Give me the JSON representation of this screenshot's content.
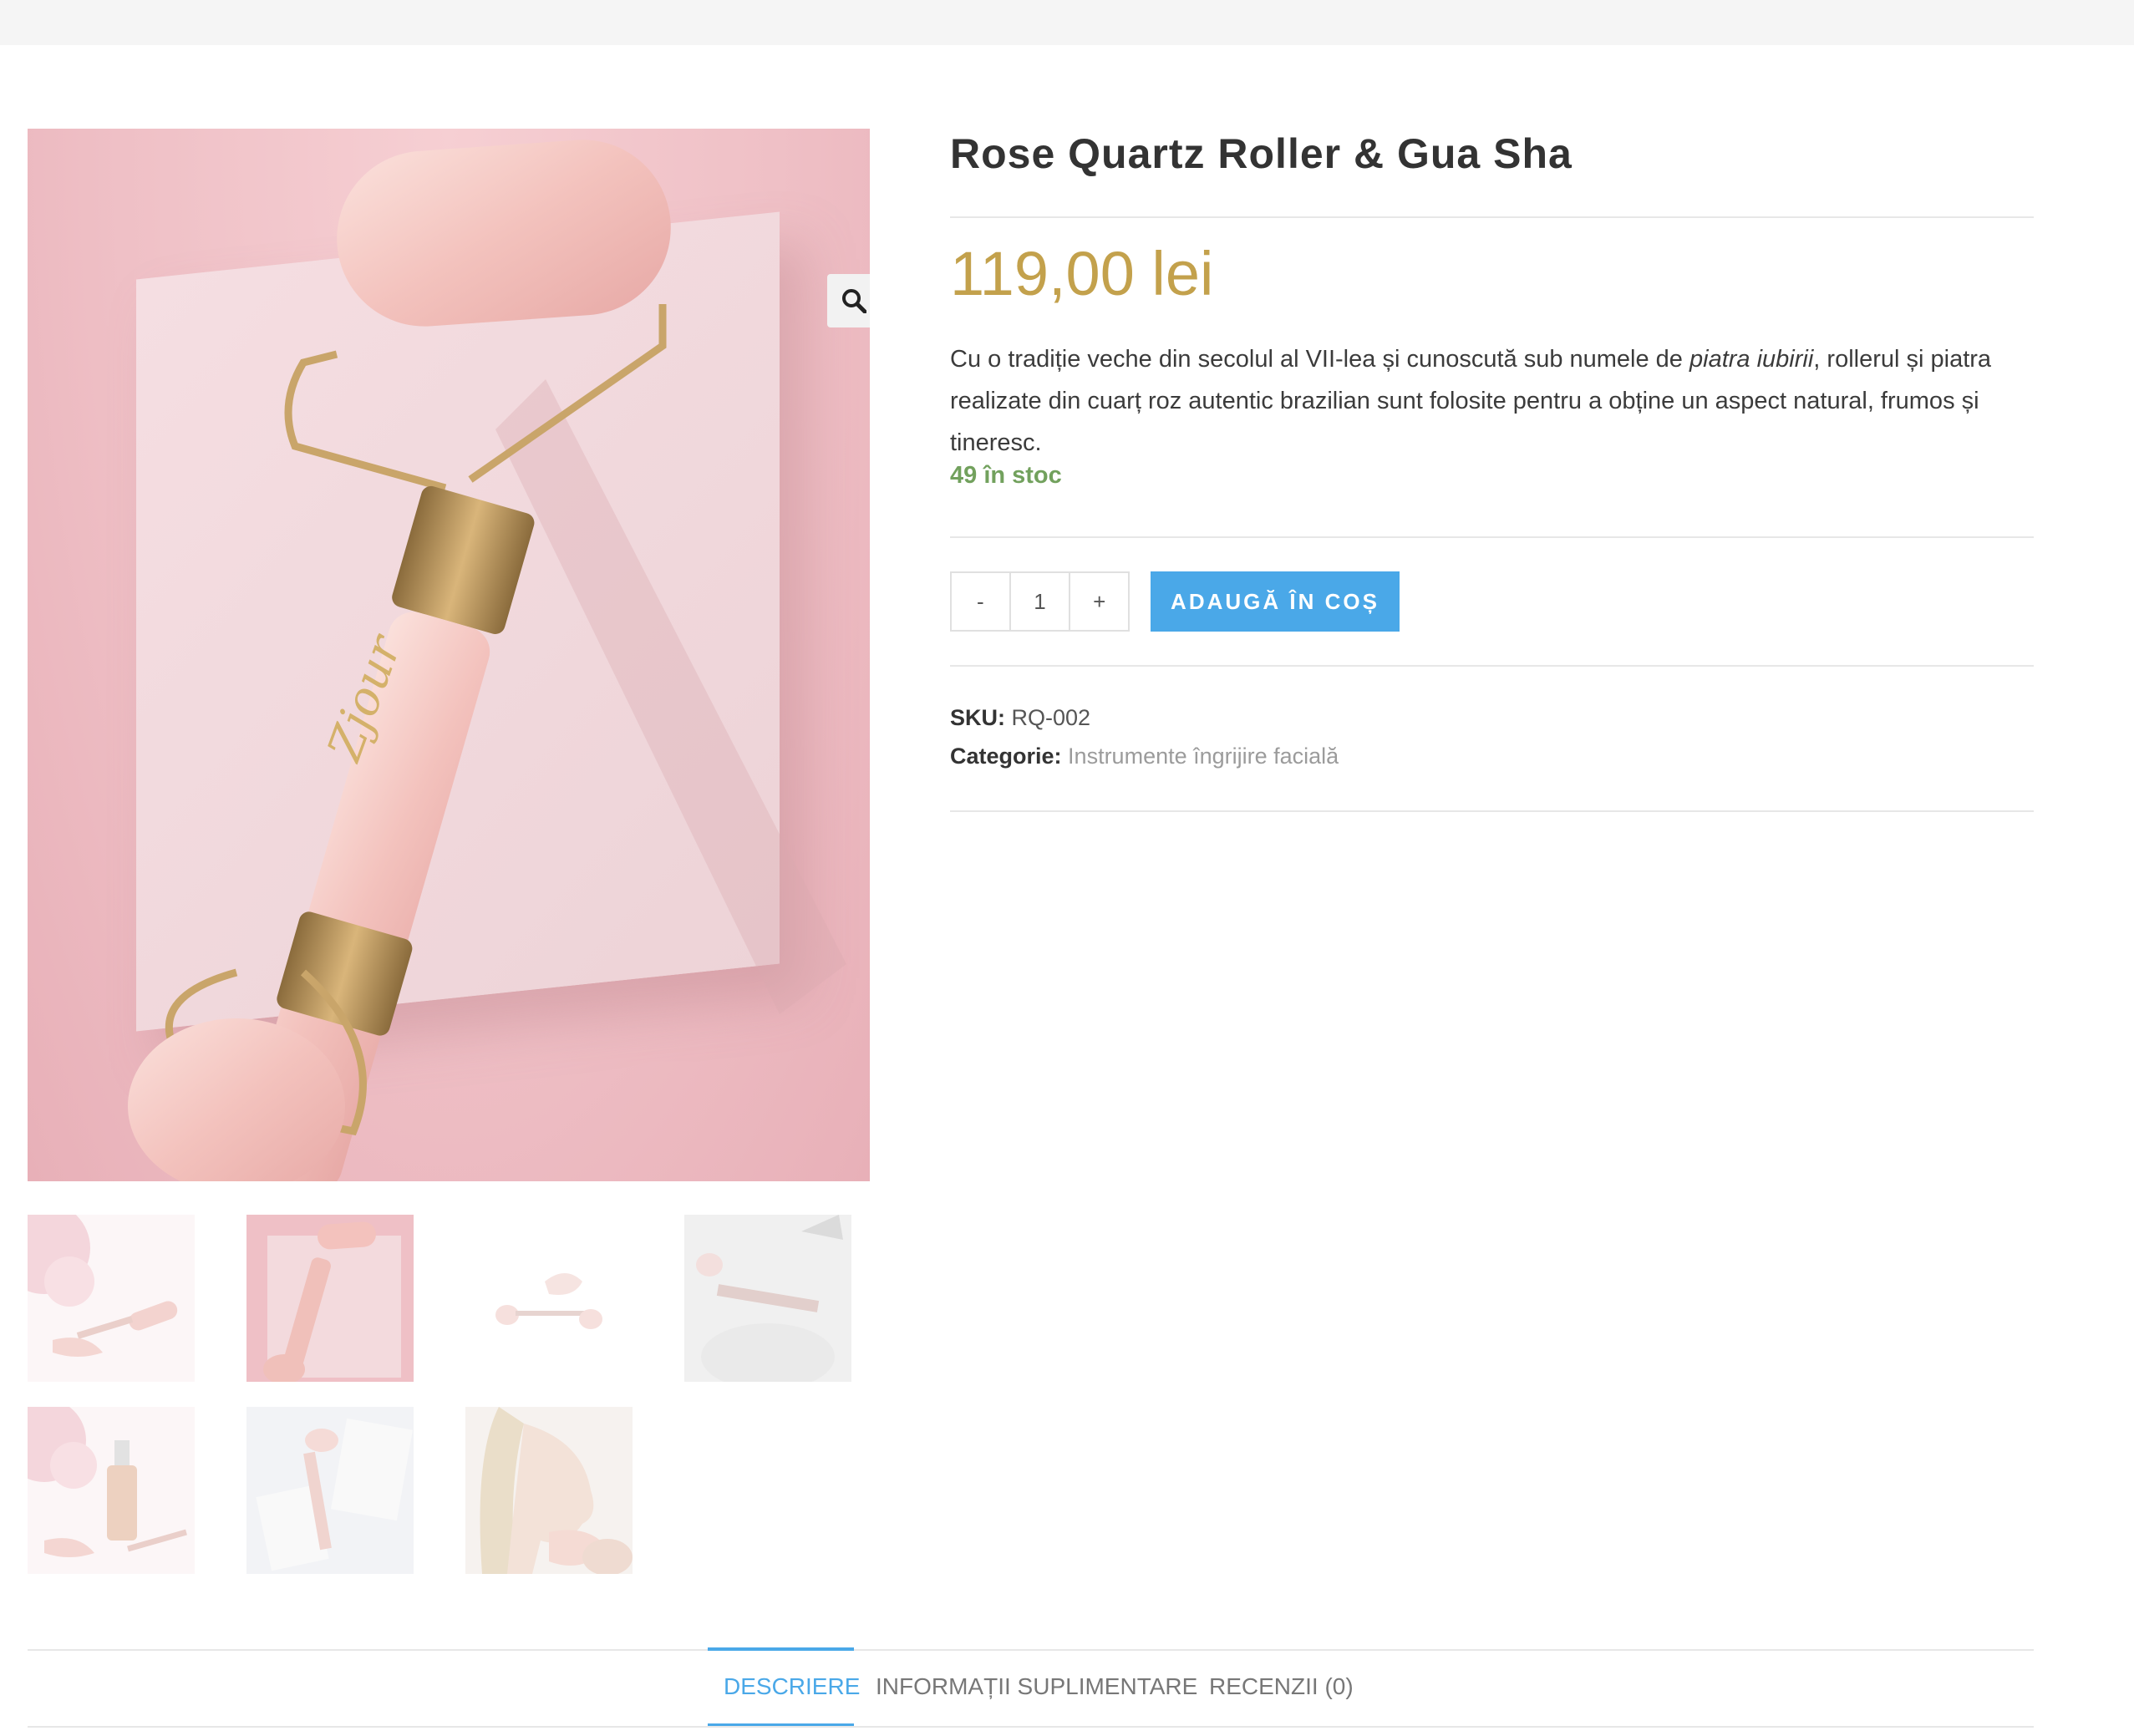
{
  "product": {
    "title": "Rose Quartz Roller & Gua Sha",
    "price": "119,00 lei",
    "description_before": "Cu o tradiție veche din secolul al VII-lea și cunoscută sub numele de ",
    "description_emphasis": "piatra iubirii",
    "description_after": ", rollerul și piatra realizate din cuarț roz autentic brazilian sunt folosite pentru a obține un aspect natural, frumos și tineresc.",
    "stock": "49 în stoc",
    "quantity": "1",
    "qty_minus": "-",
    "qty_plus": "+",
    "add_to_cart": "ADAUGĂ ÎN COȘ",
    "sku_label": "SKU:",
    "sku_value": "RQ-002",
    "category_label": "Categorie:",
    "category_value": "Instrumente îngrijire facială",
    "logo_text": "Zjour"
  },
  "gallery": {
    "zoom_icon": "magnifier-icon",
    "thumbnails": [
      "roller-flowers",
      "roller-box",
      "roller-guasha-white",
      "roller-bowl",
      "serum-flowers",
      "roller-cards",
      "woman-guasha"
    ]
  },
  "tabs": [
    {
      "label": "DESCRIERE",
      "active": true
    },
    {
      "label": "INFORMAȚII SUPLIMENTARE",
      "active": false
    },
    {
      "label": "RECENZII (0)",
      "active": false
    }
  ],
  "colors": {
    "price": "#c3a14c",
    "stock": "#72a15d",
    "accent": "#4aa8e8"
  }
}
